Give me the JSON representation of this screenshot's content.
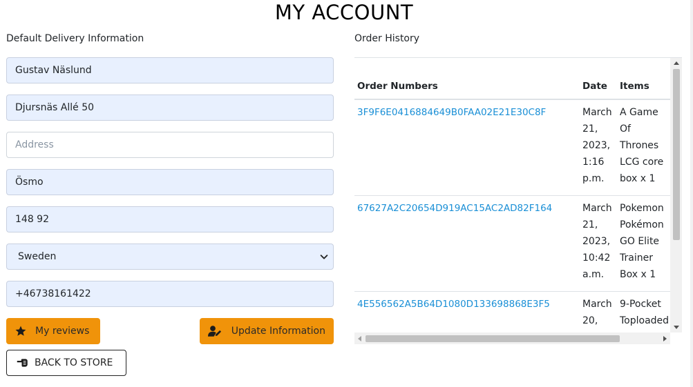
{
  "page": {
    "title": "MY ACCOUNT"
  },
  "delivery": {
    "label": "Default Delivery Information",
    "full_name": "Gustav Näslund",
    "street_address1": "Djursnäs Allé 50",
    "street_address2_placeholder": "Address",
    "town": "Ösmo",
    "postcode": "148 92",
    "country": "Sweden",
    "phone": "+46738161422"
  },
  "buttons": {
    "reviews_label": "My reviews",
    "update_label": "Update Information",
    "back_label": "BACK TO STORE"
  },
  "history": {
    "label": "Order History",
    "columns": [
      "Order Numbers",
      "Date",
      "Items"
    ],
    "orders": [
      {
        "number": "3F9F6E0416884649B0FAA02E21E30C8F",
        "date_lines": [
          "March",
          "21,",
          "2023,",
          "1:16",
          "p.m."
        ],
        "items_lines": [
          "A Game",
          "Of",
          "Thrones",
          "LCG core",
          "box x 1"
        ]
      },
      {
        "number": "67627A2C20654D919AC15AC2AD82F164",
        "date_lines": [
          "March",
          "21,",
          "2023,",
          "10:42",
          "a.m."
        ],
        "items_lines": [
          "Pokemon",
          "Pokémon",
          "GO Elite",
          "Trainer",
          "Box x 1"
        ]
      },
      {
        "number": "4E556562A5B64D1080D133698868E3F5",
        "date_lines": [
          "March",
          "20,"
        ],
        "items_lines": [
          "9-Pocket",
          "Toploaded"
        ]
      }
    ]
  },
  "icons": {
    "reviews": "star-icon",
    "update": "user-edit-icon",
    "back": "hand-pointing-left-icon",
    "chevron": "chevron-down-icon"
  },
  "colors": {
    "accent": "#f0930a",
    "link": "#1a8fd6",
    "autofill_bg": "#e8f0fe"
  }
}
